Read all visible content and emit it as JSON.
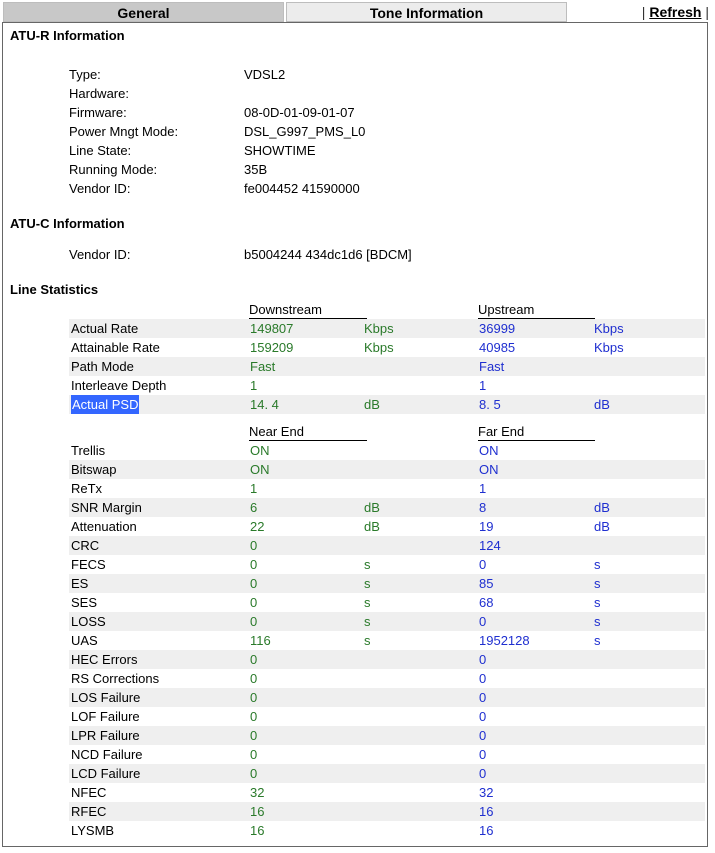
{
  "tabs": {
    "general": "General",
    "tone": "Tone Information"
  },
  "refresh": {
    "separator_left": "|",
    "label": "Refresh",
    "separator_right": "|"
  },
  "atur": {
    "title": "ATU-R Information",
    "rows": [
      {
        "key": "Type:",
        "value": "VDSL2"
      },
      {
        "key": "Hardware:",
        "value": ""
      },
      {
        "key": "Firmware:",
        "value": "08-0D-01-09-01-07"
      },
      {
        "key": "Power Mngt Mode:",
        "value": "DSL_G997_PMS_L0"
      },
      {
        "key": "Line State:",
        "value": "SHOWTIME"
      },
      {
        "key": "Running Mode:",
        "value": "35B"
      },
      {
        "key": "Vendor ID:",
        "value": "fe004452 41590000"
      }
    ]
  },
  "atuc": {
    "title": "ATU-C Information",
    "rows": [
      {
        "key": "Vendor ID:",
        "value": "b5004244 434dc1d6 [BDCM]"
      }
    ]
  },
  "stats": {
    "title": "Line Statistics",
    "group1": {
      "col1": "Downstream",
      "col2": "Upstream",
      "rows": [
        {
          "label": "Actual Rate",
          "ds": "149807",
          "ds_unit": "Kbps",
          "us": "36999",
          "us_unit": "Kbps"
        },
        {
          "label": "Attainable Rate",
          "ds": "159209",
          "ds_unit": "Kbps",
          "us": "40985",
          "us_unit": "Kbps"
        },
        {
          "label": "Path Mode",
          "ds": "Fast",
          "ds_unit": "",
          "us": "Fast",
          "us_unit": ""
        },
        {
          "label": "Interleave Depth",
          "ds": "1",
          "ds_unit": "",
          "us": "1",
          "us_unit": ""
        },
        {
          "label": "Actual PSD",
          "ds": "14. 4",
          "ds_unit": "dB",
          "us": "8. 5",
          "us_unit": "dB"
        }
      ]
    },
    "group2": {
      "col1": "Near End",
      "col2": "Far End",
      "rows": [
        {
          "label": "Trellis",
          "ds": "ON",
          "ds_unit": "",
          "us": "ON",
          "us_unit": ""
        },
        {
          "label": "Bitswap",
          "ds": "ON",
          "ds_unit": "",
          "us": "ON",
          "us_unit": ""
        },
        {
          "label": "ReTx",
          "ds": "1",
          "ds_unit": "",
          "us": "1",
          "us_unit": ""
        },
        {
          "label": "SNR Margin",
          "ds": "6",
          "ds_unit": "dB",
          "us": "8",
          "us_unit": "dB"
        },
        {
          "label": "Attenuation",
          "ds": "22",
          "ds_unit": "dB",
          "us": "19",
          "us_unit": "dB"
        },
        {
          "label": "CRC",
          "ds": "0",
          "ds_unit": "",
          "us": "124",
          "us_unit": ""
        },
        {
          "label": "FECS",
          "ds": "0",
          "ds_unit": "s",
          "us": "0",
          "us_unit": "s"
        },
        {
          "label": "ES",
          "ds": "0",
          "ds_unit": "s",
          "us": "85",
          "us_unit": "s"
        },
        {
          "label": "SES",
          "ds": "0",
          "ds_unit": "s",
          "us": "68",
          "us_unit": "s"
        },
        {
          "label": "LOSS",
          "ds": "0",
          "ds_unit": "s",
          "us": "0",
          "us_unit": "s"
        },
        {
          "label": "UAS",
          "ds": "116",
          "ds_unit": "s",
          "us": "1952128",
          "us_unit": "s"
        },
        {
          "label": "HEC Errors",
          "ds": "0",
          "ds_unit": "",
          "us": "0",
          "us_unit": ""
        },
        {
          "label": "RS Corrections",
          "ds": "0",
          "ds_unit": "",
          "us": "0",
          "us_unit": ""
        },
        {
          "label": "LOS Failure",
          "ds": "0",
          "ds_unit": "",
          "us": "0",
          "us_unit": ""
        },
        {
          "label": "LOF Failure",
          "ds": "0",
          "ds_unit": "",
          "us": "0",
          "us_unit": ""
        },
        {
          "label": "LPR Failure",
          "ds": "0",
          "ds_unit": "",
          "us": "0",
          "us_unit": ""
        },
        {
          "label": "NCD Failure",
          "ds": "0",
          "ds_unit": "",
          "us": "0",
          "us_unit": ""
        },
        {
          "label": "LCD Failure",
          "ds": "0",
          "ds_unit": "",
          "us": "0",
          "us_unit": ""
        },
        {
          "label": "NFEC",
          "ds": "32",
          "ds_unit": "",
          "us": "32",
          "us_unit": ""
        },
        {
          "label": "RFEC",
          "ds": "16",
          "ds_unit": "",
          "us": "16",
          "us_unit": ""
        },
        {
          "label": "LYSMB",
          "ds": "16",
          "ds_unit": "",
          "us": "16",
          "us_unit": ""
        }
      ]
    }
  },
  "colors": {
    "near_downstream": "#2a7a2a",
    "far_upstream": "#1f2fd0",
    "row_alt": "#efefef",
    "selection": "#3366ff"
  }
}
